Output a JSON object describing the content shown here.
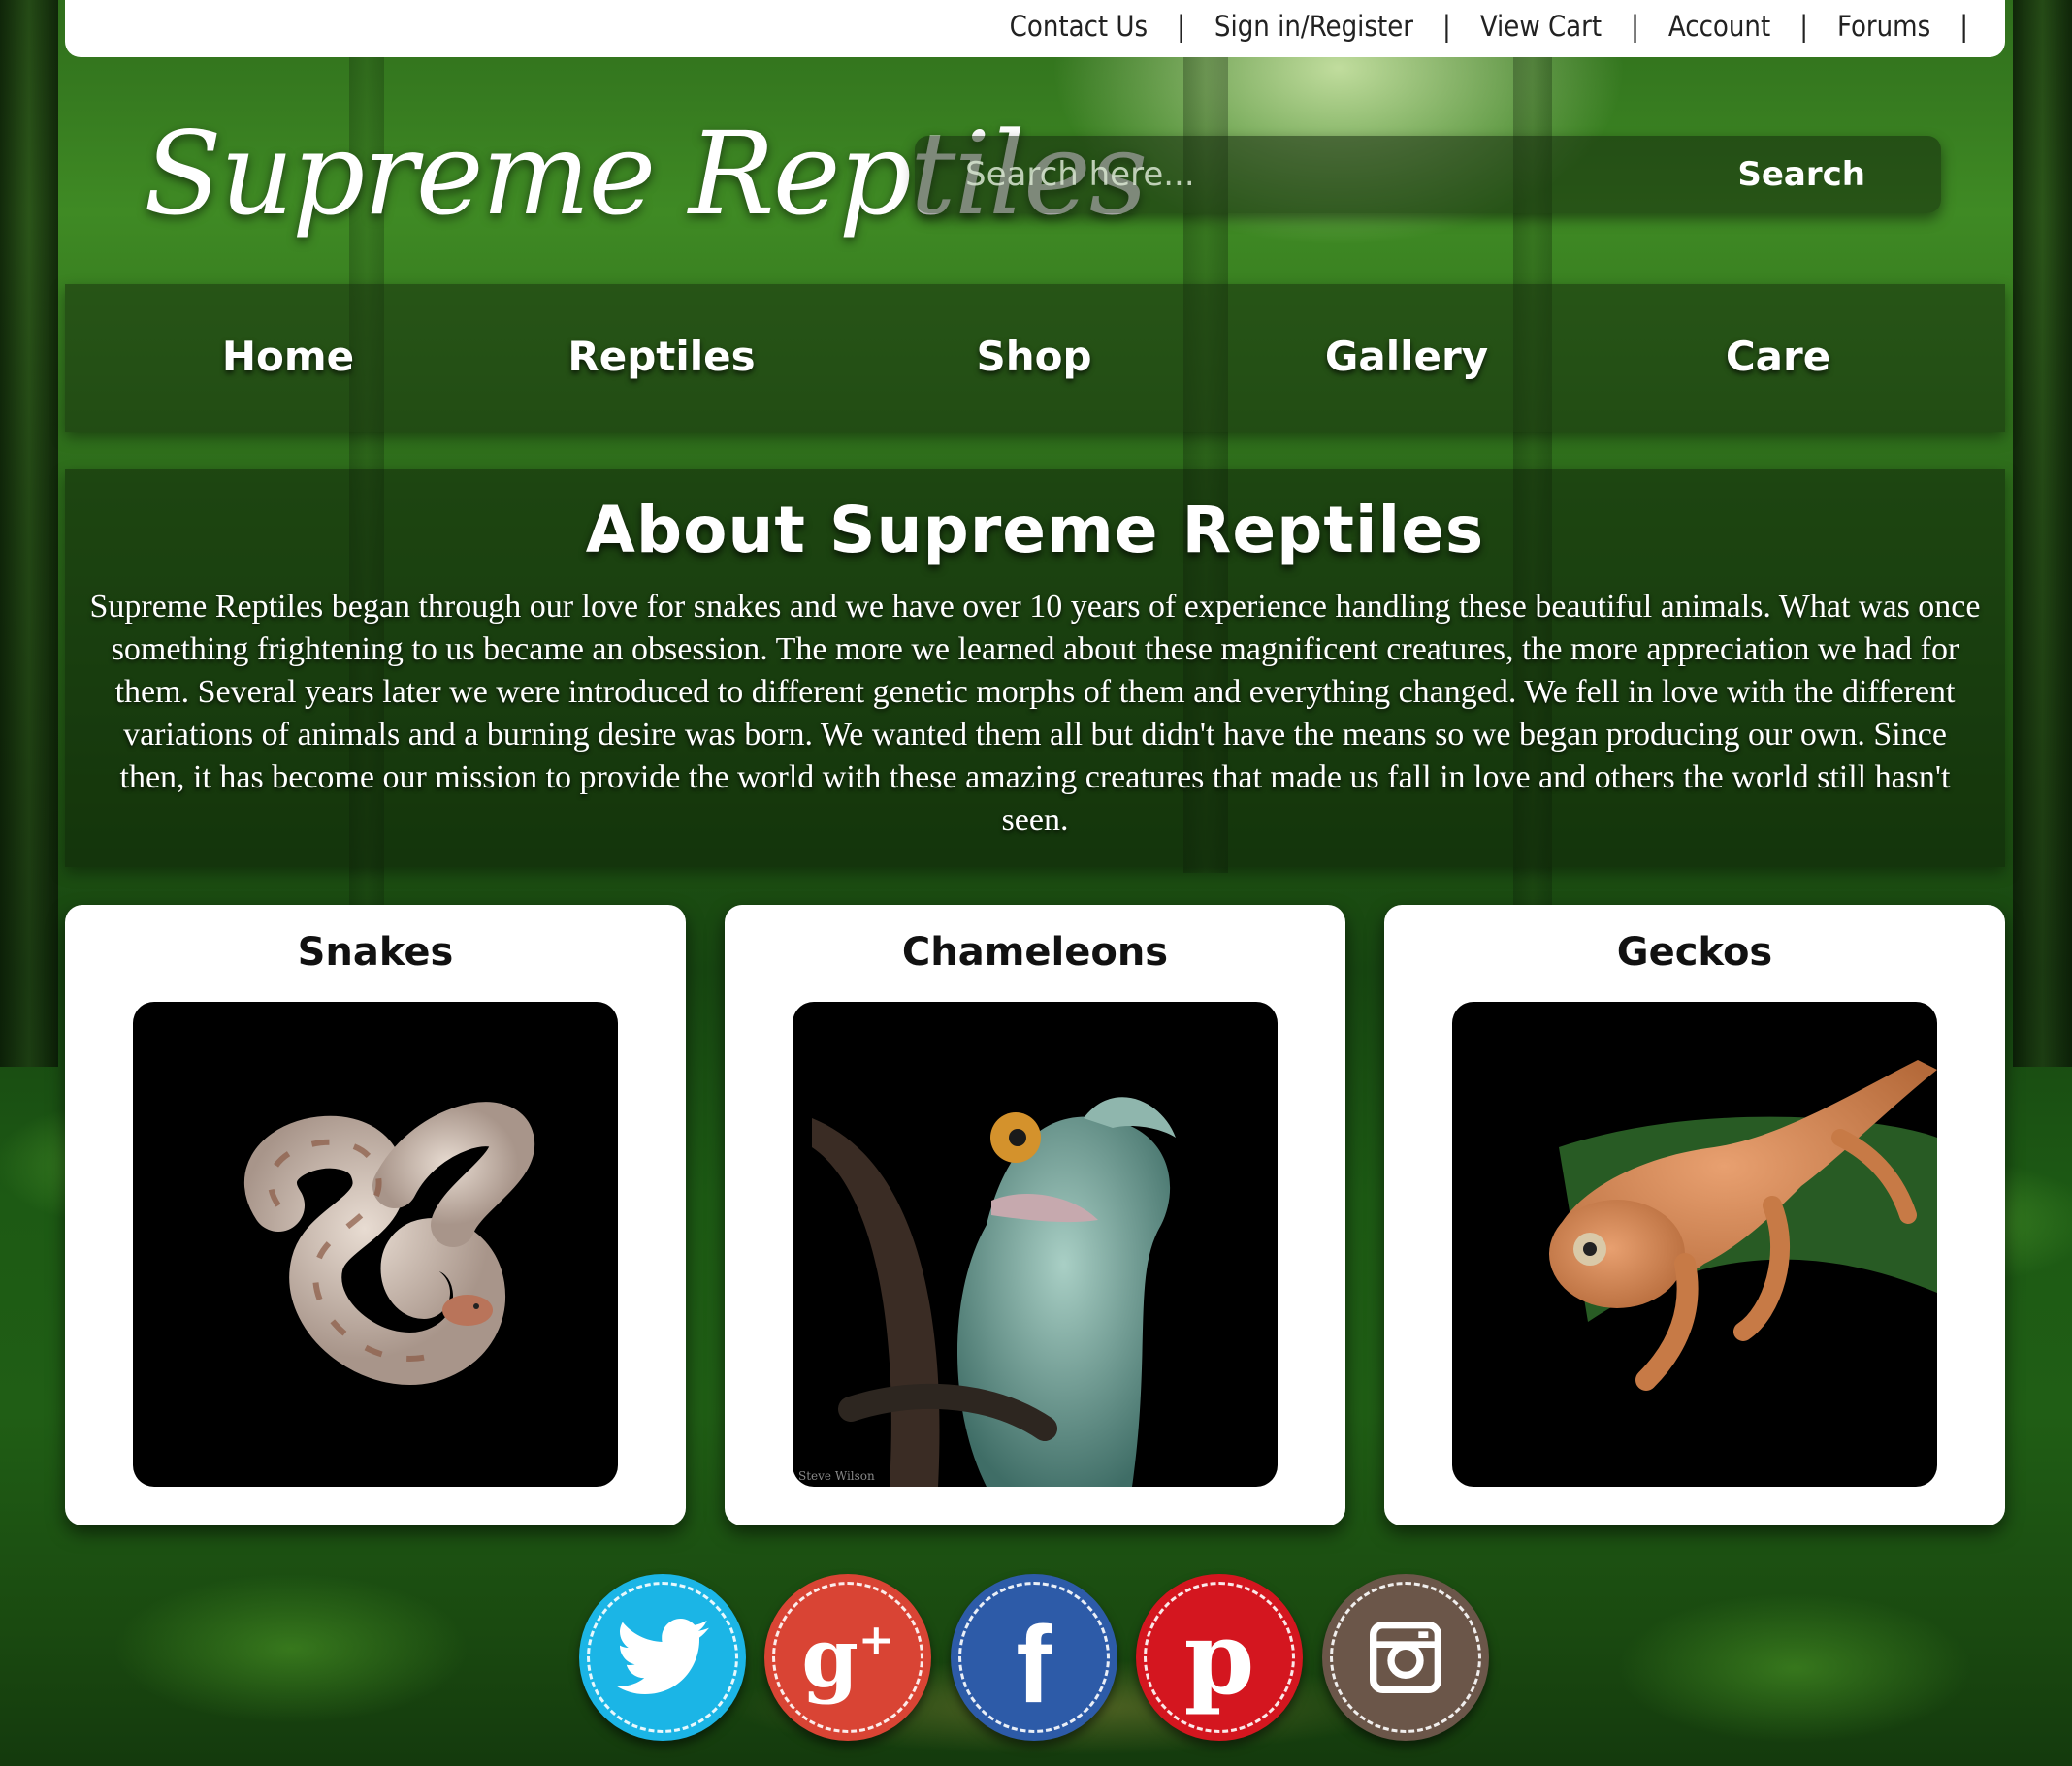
{
  "top_links": {
    "contact": "Contact Us",
    "sign_in": "Sign in/Register",
    "cart": "View Cart",
    "account": "Account",
    "forums": "Forums",
    "separator": "|"
  },
  "logo": "Supreme Reptiles",
  "search": {
    "placeholder": "Search here...",
    "button": "Search"
  },
  "nav": [
    "Home",
    "Reptiles",
    "Shop",
    "Gallery",
    "Care"
  ],
  "about": {
    "title": "About Supreme Reptiles",
    "body": "Supreme Reptiles began through our love for snakes and we have over 10 years of experience handling these beautiful animals. What was once something frightening to us became an obsession. The more we learned about these magnificent creatures, the more appreciation we had for them. Several years later we were introduced to different genetic morphs of them and everything changed. We fell in love with the different variations of animals and a burning desire was born. We wanted them all but didn't have the means so we began producing our own. Since then, it has become our mission to provide the world with these amazing creatures that made us fall in love and others the world still hasn't seen."
  },
  "cards": [
    {
      "title": "Snakes"
    },
    {
      "title": "Chameleons",
      "credit": "Steve Wilson"
    },
    {
      "title": "Geckos"
    }
  ],
  "social": [
    {
      "name": "twitter-icon",
      "color": "#1bb5e6"
    },
    {
      "name": "google-plus-icon",
      "color": "#d94434"
    },
    {
      "name": "facebook-icon",
      "color": "#2d5ba8"
    },
    {
      "name": "pinterest-icon",
      "color": "#d4161f"
    },
    {
      "name": "instagram-icon",
      "color": "#6b5649"
    }
  ]
}
